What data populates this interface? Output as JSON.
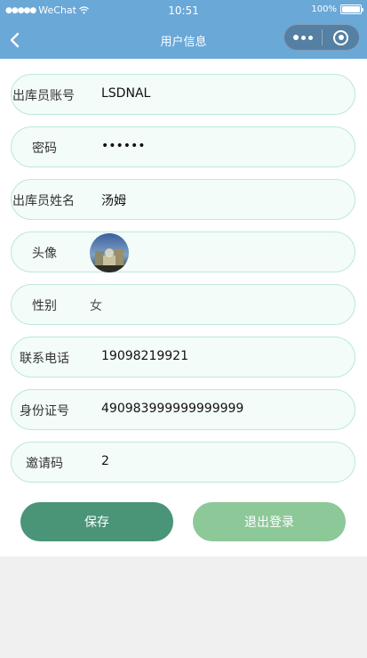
{
  "status_bar": {
    "carrier": "WeChat",
    "time": "10:51",
    "battery": "100%"
  },
  "nav": {
    "title": "用户信息"
  },
  "form": {
    "account": {
      "label": "出库员账号",
      "value": "LSDNAL"
    },
    "password": {
      "label": "密码",
      "value": "••••••"
    },
    "name": {
      "label": "出库员姓名",
      "value": "汤姆"
    },
    "avatar": {
      "label": "头像"
    },
    "gender": {
      "label": "性别",
      "value": "女"
    },
    "phone": {
      "label": "联系电话",
      "value": "19098219921"
    },
    "id_number": {
      "label": "身份证号",
      "value": "490983999999999999"
    },
    "invite_code": {
      "label": "邀请码",
      "value": "2"
    }
  },
  "buttons": {
    "save": "保存",
    "logout": "退出登录"
  }
}
